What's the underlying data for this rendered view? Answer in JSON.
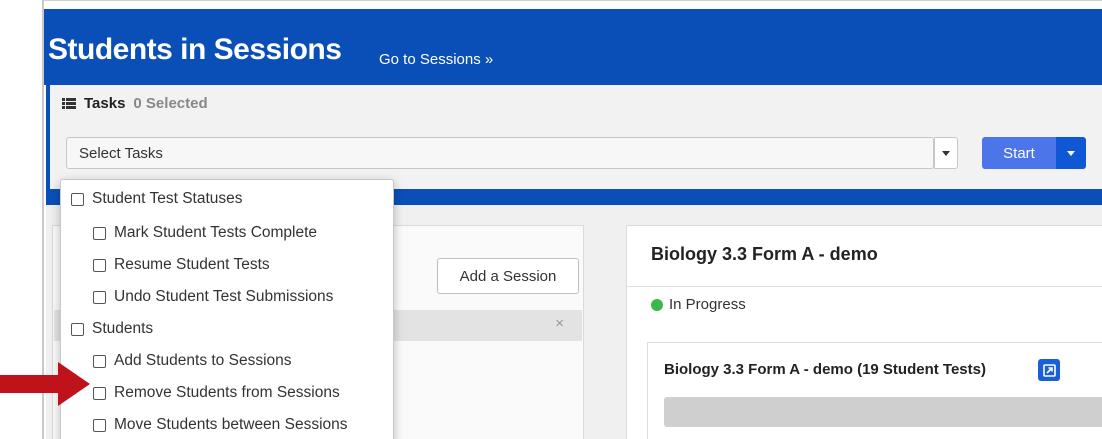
{
  "header": {
    "title": "Students in Sessions",
    "goto_link": "Go to Sessions »"
  },
  "tasks": {
    "label": "Tasks",
    "selected_count": "0 Selected",
    "select_placeholder": "Select Tasks",
    "start_label": "Start"
  },
  "dropdown": {
    "items": [
      {
        "label": "Student Test Statuses",
        "level": 0
      },
      {
        "label": "Mark Student Tests Complete",
        "level": 1
      },
      {
        "label": "Resume Student Tests",
        "level": 1
      },
      {
        "label": "Undo Student Test Submissions",
        "level": 1
      },
      {
        "label": "Students",
        "level": 0
      },
      {
        "label": "Add Students to Sessions",
        "level": 1
      },
      {
        "label": "Remove Students from Sessions",
        "level": 1
      },
      {
        "label": "Move Students between Sessions",
        "level": 1
      }
    ]
  },
  "left_panel": {
    "add_session_label": "Add a Session",
    "close_glyph": "×"
  },
  "session": {
    "name": "Biology 3.3 Form A - demo",
    "status": "In Progress",
    "status_color": "#3cb84a",
    "tests_title": "Biology 3.3 Form A - demo (19 Student Tests)"
  },
  "annotation": {
    "arrow_color": "#c0121b"
  },
  "colors": {
    "header_blue": "#0a4fb8",
    "start_button": "#4b75e8"
  }
}
